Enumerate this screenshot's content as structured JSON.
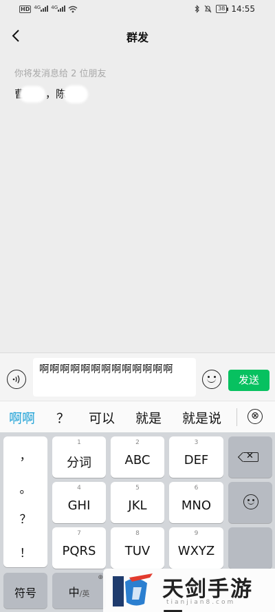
{
  "status_bar": {
    "left_badges": [
      "HD",
      "4G",
      "4G"
    ],
    "battery": "38",
    "time": "14:55"
  },
  "nav": {
    "back_icon": "chevron-left-icon",
    "back_glyph": "<",
    "title": "群发"
  },
  "recipients": {
    "hint": "你将发消息给 2 位朋友",
    "first_visible": "曹",
    "separator": "，",
    "second_visible": "陈"
  },
  "composer": {
    "message": "啊啊啊啊啊啊啊啊啊啊啊啊啊",
    "send_label": "发送",
    "voice_icon": "voice-icon",
    "emoji_icon": "emoji-icon"
  },
  "candidates": {
    "items": [
      "啊啊",
      "？",
      "可以",
      "就是",
      "就是说"
    ],
    "close_glyph": "⊗"
  },
  "keyboard": {
    "punctuation": [
      "，",
      "。",
      "？",
      "！"
    ],
    "keys": [
      {
        "num": "1",
        "label": "分词"
      },
      {
        "num": "2",
        "label": "ABC"
      },
      {
        "num": "3",
        "label": "DEF"
      },
      {
        "num": "4",
        "label": "GHI"
      },
      {
        "num": "5",
        "label": "JKL"
      },
      {
        "num": "6",
        "label": "MNO"
      },
      {
        "num": "7",
        "label": "PQRS"
      },
      {
        "num": "8",
        "label": "TUV"
      },
      {
        "num": "9",
        "label": "WXYZ"
      }
    ],
    "symbol_key": "符号",
    "lang_key_main": "中",
    "lang_key_sub": "/英",
    "backspace_icon": "backspace-icon",
    "emoji_key_icon": "smile-icon"
  },
  "watermark": {
    "text": "天剑手游网",
    "url": "tianjian8.com"
  }
}
